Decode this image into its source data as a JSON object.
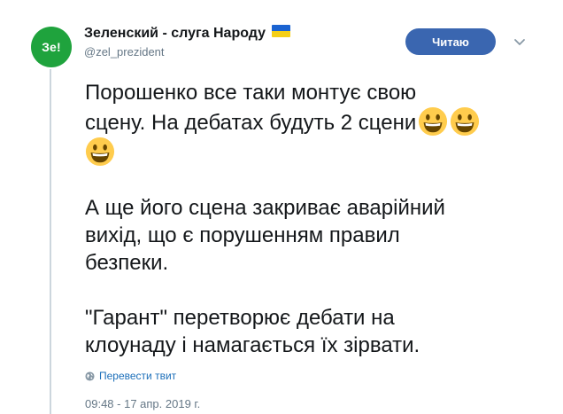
{
  "author": {
    "avatar_text": "Зе!",
    "display_name": "Зеленский - слуга Народу",
    "handle": "@zel_prezident",
    "flag_colors": [
      "#1b63d1",
      "#f5cf16"
    ]
  },
  "actions": {
    "follow_label": "Читаю"
  },
  "tweet": {
    "para1_line1": "Порошенко все таки монтує свою",
    "para1_line2": "сцену. На дебатах будуть 2 сцени",
    "para2_line1": "А ще його сцена закриває аварійний",
    "para2_line2": "вихід, що є порушенням правил",
    "para2_line3": "безпеки.",
    "para3_line1": "\"Гарант\" перетворює дебати на",
    "para3_line2": "клоунаду і намагається їх зірвати.",
    "emoji_icon": "grinning-face-emoji"
  },
  "translate_label": "Перевести твит",
  "timestamp": "09:48 - 17 апр. 2019 г.",
  "colors": {
    "avatar_bg": "#1fa33d",
    "button_bg": "#3a66b0",
    "link": "#1c6fba",
    "muted": "#657786"
  }
}
